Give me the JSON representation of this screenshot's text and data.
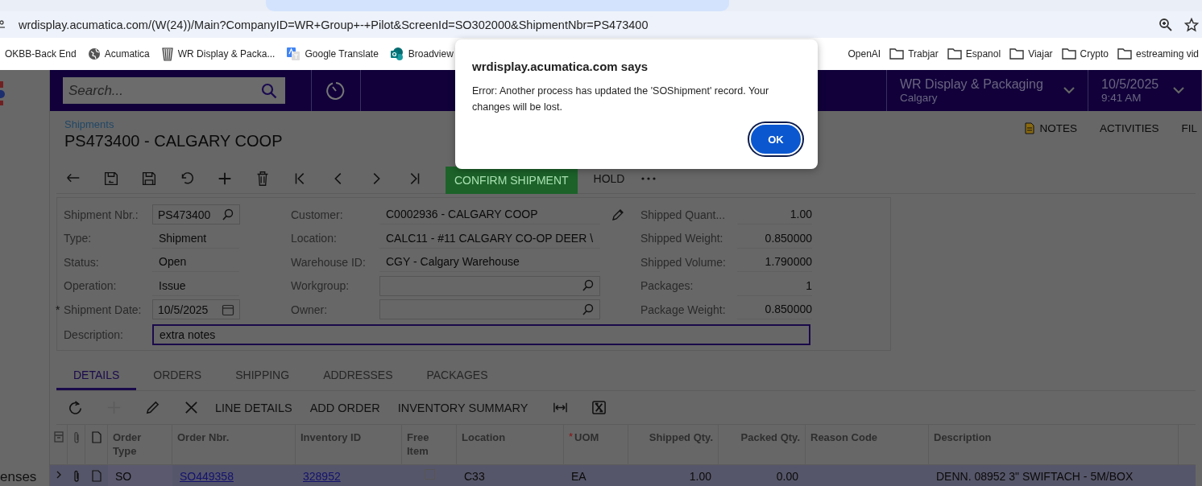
{
  "browser": {
    "url": "wrdisplay.acumatica.com/(W(24))/Main?CompanyID=WR+Group+-+Pilot&ScreenId=SO302000&ShipmentNbr=PS473400",
    "bookmarks": [
      {
        "label": "OKBB-Back End"
      },
      {
        "label": "Acumatica"
      },
      {
        "label": "WR Display & Packa..."
      },
      {
        "label": "Google Translate"
      },
      {
        "label": "Broadview"
      },
      {
        "label": "OpenAI"
      },
      {
        "label": "Trabjar"
      },
      {
        "label": "Espanol"
      },
      {
        "label": "Viajar"
      },
      {
        "label": "Crypto"
      },
      {
        "label": "estreaming vid"
      }
    ]
  },
  "dialog": {
    "title": "wrdisplay.acumatica.com says",
    "message": "Error: Another process has updated the 'SOShipment' record. Your changes will be lost.",
    "button": "OK"
  },
  "sidebar": {
    "label": "enses"
  },
  "topbar": {
    "search_placeholder": "Search...",
    "company": "WR Display & Packaging",
    "branch": "Calgary",
    "date": "10/5/2025",
    "time": "9:41 AM"
  },
  "breadcrumb": "Shipments",
  "title": "PS473400 - CALGARY COOP",
  "header_links": [
    "NOTES",
    "ACTIVITIES",
    "FIL"
  ],
  "toolbar": {
    "primary": "CONFIRM SHIPMENT",
    "secondary": "HOLD"
  },
  "form": {
    "columns": [
      [
        {
          "label": "Shipment Nbr.:",
          "value": "PS473400",
          "kind": "lookup"
        },
        {
          "label": "Type:",
          "value": "Shipment",
          "kind": "plain"
        },
        {
          "label": "Status:",
          "value": "Open",
          "kind": "plain"
        },
        {
          "label": "Operation:",
          "value": "Issue",
          "kind": "plain"
        },
        {
          "marker": "*",
          "label": "Shipment Date:",
          "value": "10/5/2025",
          "kind": "date"
        }
      ],
      [
        {
          "label": "Customer:",
          "value": "C0002936 - CALGARY COOP",
          "kind": "edit"
        },
        {
          "label": "Location:",
          "value": "CALC11 - #11 CALGARY CO-OP DEER \\",
          "kind": "plain"
        },
        {
          "label": "Warehouse ID:",
          "value": "CGY - Calgary Warehouse",
          "kind": "plain"
        },
        {
          "label": "Workgroup:",
          "kind": "lookup"
        },
        {
          "label": "Owner:",
          "kind": "lookup"
        }
      ],
      [
        {
          "label": "Shipped Quant...",
          "value": "1.00",
          "kind": "number"
        },
        {
          "label": "Shipped Weight:",
          "value": "0.850000",
          "kind": "number"
        },
        {
          "label": "Shipped Volume:",
          "value": "1.790000",
          "kind": "number"
        },
        {
          "label": "Packages:",
          "value": "1",
          "kind": "number"
        },
        {
          "label": "Package Weight:",
          "value": "0.850000",
          "kind": "number"
        }
      ]
    ],
    "description": {
      "label": "Description:",
      "value": "extra notes",
      "focused": true
    }
  },
  "tabs": [
    {
      "label": "DETAILS",
      "selected": true
    },
    {
      "label": "ORDERS",
      "selected": false
    },
    {
      "label": "SHIPPING",
      "selected": false
    },
    {
      "label": "ADDRESSES",
      "selected": false
    },
    {
      "label": "PACKAGES",
      "selected": false
    }
  ],
  "grid_toolbar": [
    {
      "kind": "refresh",
      "disabled": false
    },
    {
      "kind": "add",
      "disabled": true
    },
    {
      "kind": "edit",
      "disabled": false
    },
    {
      "kind": "delete",
      "disabled": false
    },
    {
      "kind": "text",
      "label": "LINE DETAILS",
      "disabled": false
    },
    {
      "kind": "text",
      "label": "ADD ORDER",
      "disabled": false
    },
    {
      "kind": "text",
      "label": "INVENTORY SUMMARY",
      "disabled": false
    },
    {
      "kind": "fit",
      "disabled": false
    },
    {
      "kind": "excel",
      "disabled": false
    }
  ],
  "table": {
    "columns": [
      {
        "label": "Order Type"
      },
      {
        "label": "Order Nbr."
      },
      {
        "label": "Inventory ID"
      },
      {
        "label": "Free Item"
      },
      {
        "label": "Location"
      },
      {
        "marker": "*",
        "label": "UOM"
      },
      {
        "label": "Shipped Qty."
      },
      {
        "label": "Packed Qty."
      },
      {
        "label": "Reason Code"
      },
      {
        "label": "Description"
      }
    ],
    "rows": [
      {
        "selected": true,
        "cells": [
          {
            "kind": "text",
            "value": "SO"
          },
          {
            "kind": "link",
            "value": "SO449358"
          },
          {
            "kind": "link",
            "value": "328952"
          },
          {
            "kind": "checkbox",
            "checked": false
          },
          {
            "kind": "text",
            "value": "C33"
          },
          {
            "kind": "text",
            "value": "EA"
          },
          {
            "kind": "text",
            "value": "1.00"
          },
          {
            "kind": "text",
            "value": "0.00"
          },
          {
            "kind": "empty"
          },
          {
            "kind": "text",
            "value": "DENN. 08952 3\" SWIFTACH - 5M/BOX"
          }
        ]
      }
    ]
  }
}
